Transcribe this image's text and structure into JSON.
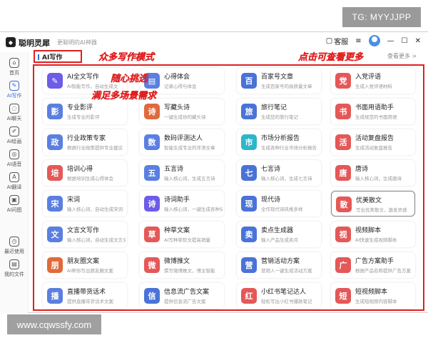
{
  "watermark_top": "TG: MYYJJPP",
  "watermark_bottom": "www.cqwssfy.com",
  "app": {
    "name": "聪明灵犀",
    "slogan": "更聪明的AI神器"
  },
  "titlebar": {
    "service": "客服",
    "menu_glyph": "≡",
    "min_glyph": "—",
    "max_glyph": "☐",
    "close_glyph": "✕"
  },
  "sidebar": [
    {
      "label": "首页",
      "glyph": "⌂"
    },
    {
      "label": "AI写作",
      "glyph": "✎",
      "active": true
    },
    {
      "label": "AI聊天",
      "glyph": "◌"
    },
    {
      "label": "AI绘画",
      "glyph": "✐"
    },
    {
      "label": "AI语音",
      "glyph": "◎"
    },
    {
      "label": "AI翻译",
      "glyph": "A"
    },
    {
      "label": "AI问图",
      "glyph": "▣"
    },
    {
      "label": "最近使用",
      "glyph": "◷"
    },
    {
      "label": "我的文件",
      "glyph": "▤"
    }
  ],
  "section_label": "AI写作",
  "more_link": "查看更多 >",
  "annotations": {
    "modes": "众多写作模式",
    "more": "点击可查看更多",
    "pick": "随心挑选",
    "meet": "满足多场景需求"
  },
  "cards": [
    {
      "title": "AI全文写作",
      "desc": "AI智能写作，自动生成文",
      "color": "#6c5ce7",
      "glyph": "✎"
    },
    {
      "title": "心得体会",
      "desc": "记录心得与体会",
      "color": "#5b7fe0",
      "glyph": "▤"
    },
    {
      "title": "百家号文章",
      "desc": "生成百家号的高质量文章",
      "color": "#4a73d8",
      "glyph": "百"
    },
    {
      "title": "入党评语",
      "desc": "生成入党评语材料",
      "color": "#e45858",
      "glyph": "党"
    },
    {
      "title": "专业影评",
      "desc": "生成专业的影评",
      "color": "#5b7fe0",
      "glyph": "影"
    },
    {
      "title": "写藏头诗",
      "desc": "一键生成你的藏头诗",
      "color": "#e06a3c",
      "glyph": "诗"
    },
    {
      "title": "旅行笔记",
      "desc": "生成您的旅行笔记",
      "color": "#4a73d8",
      "glyph": "旅"
    },
    {
      "title": "书面用语助手",
      "desc": "生成规范的书面用语",
      "color": "#e45858",
      "glyph": "书"
    },
    {
      "title": "行业政策专家",
      "desc": "根据行业政策提供专业建议",
      "color": "#5b7fe0",
      "glyph": "政"
    },
    {
      "title": "数码评测达人",
      "desc": "智能生成专业的评测文章",
      "color": "#5b7fe0",
      "glyph": "数"
    },
    {
      "title": "市场分析报告",
      "desc": "生成各种行业市场分析报告",
      "color": "#2fb5c9",
      "glyph": "市"
    },
    {
      "title": "活动复盘报告",
      "desc": "生成活动复盘报告",
      "color": "#e45858",
      "glyph": "活"
    },
    {
      "title": "培训心得",
      "desc": "根据培训生成心得体会",
      "color": "#e45858",
      "glyph": "培"
    },
    {
      "title": "五言诗",
      "desc": "输入核心词，生成五言诗",
      "color": "#5b7fe0",
      "glyph": "五"
    },
    {
      "title": "七言诗",
      "desc": "输入核心词，生成七言诗",
      "color": "#4a73d8",
      "glyph": "七"
    },
    {
      "title": "唐诗",
      "desc": "输入核心词，生成唐诗",
      "color": "#e45858",
      "glyph": "唐"
    },
    {
      "title": "宋词",
      "desc": "输入核心词，自动生成宋词",
      "color": "#5b7fe0",
      "glyph": "宋"
    },
    {
      "title": "诗词助手",
      "desc": "输入核心词，一键生成各种诗词",
      "color": "#6c5ce7",
      "glyph": "诗"
    },
    {
      "title": "现代诗",
      "desc": "全作现代诗风格多样",
      "color": "#4a73d8",
      "glyph": "现"
    },
    {
      "title": "优美散文",
      "desc": "写出优美散文，激发灵感",
      "color": "#e45858",
      "glyph": "散",
      "selected": true
    },
    {
      "title": "文言文写作",
      "desc": "输入核心词，自动生成文言文",
      "color": "#5b7fe0",
      "glyph": "文"
    },
    {
      "title": "种草文案",
      "desc": "AI写种草软文提高销量",
      "color": "#e45858",
      "glyph": "草"
    },
    {
      "title": "卖点生成器",
      "desc": "输入产品生成卖点",
      "color": "#4a73d8",
      "glyph": "卖"
    },
    {
      "title": "视频脚本",
      "desc": "AI快速生成视频脚本",
      "color": "#e45858",
      "glyph": "视"
    },
    {
      "title": "朋友圈文案",
      "desc": "AI帮你写出朋友圈文案",
      "color": "#e06a3c",
      "glyph": "朋"
    },
    {
      "title": "微博推文",
      "desc": "撰写微博推文，博主智能",
      "color": "#e45858",
      "glyph": "微"
    },
    {
      "title": "营销活动方案",
      "desc": "营销人一键生成活动方案",
      "color": "#4a73d8",
      "glyph": "营"
    },
    {
      "title": "广告方案助手",
      "desc": "根据产品名称提供广告方案",
      "color": "#e45858",
      "glyph": "广"
    },
    {
      "title": "直播带货话术",
      "desc": "提供直播带货话术文案",
      "color": "#5b7fe0",
      "glyph": "播"
    },
    {
      "title": "信息流广告文案",
      "desc": "提供信息流广告文案",
      "color": "#4a73d8",
      "glyph": "信"
    },
    {
      "title": "小红书笔记达人",
      "desc": "轻松写出小红书爆款笔记",
      "color": "#e45858",
      "glyph": "红"
    },
    {
      "title": "短视频脚本",
      "desc": "生成短视频内容脚本",
      "color": "#e45858",
      "glyph": "短"
    }
  ]
}
